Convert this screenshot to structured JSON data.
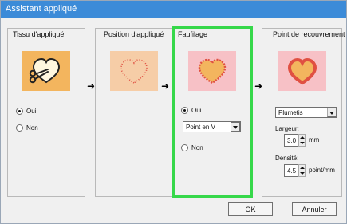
{
  "window": {
    "title": "Assistant appliqué"
  },
  "panels": [
    {
      "title": "Tissu d'appliqué"
    },
    {
      "title": "Position d'appliqué"
    },
    {
      "title": "Faufilage"
    },
    {
      "title": "Point de recouvrement"
    }
  ],
  "panel0": {
    "radios": [
      {
        "label": "Oui"
      },
      {
        "label": "Non"
      }
    ]
  },
  "panel2": {
    "radios": [
      {
        "label": "Oui"
      },
      {
        "label": "Non"
      }
    ],
    "select_value": "Point en V"
  },
  "panel3": {
    "select_value": "Plumetis",
    "largeur_label": "Largeur:",
    "largeur_value": "3.0",
    "largeur_unit": "mm",
    "densite_label": "Densité:",
    "densite_value": "4.5",
    "densite_unit": "point/mm"
  },
  "buttons": {
    "ok": "OK",
    "cancel": "Annuler"
  },
  "icons": {
    "arrow": "right-arrow-icon",
    "thumb0": "scissors-heart-icon",
    "thumb1": "dotted-heart-icon",
    "thumb2": "zigzag-heart-icon",
    "thumb3": "satin-heart-icon"
  },
  "colors": {
    "titlebar": "#3c8bd8",
    "thumb_orange": "#f3b55e",
    "thumb_peach": "#f6cda7",
    "thumb_pink": "#f7c1c6",
    "heart_red": "#e05042",
    "highlight": "#36d84a"
  }
}
